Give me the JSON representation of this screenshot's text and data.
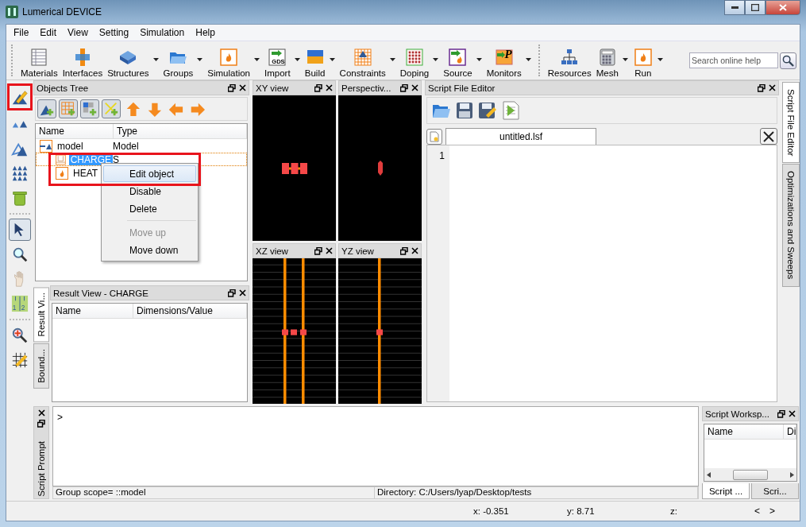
{
  "window": {
    "title": "Lumerical DEVICE"
  },
  "menu": [
    "File",
    "Edit",
    "View",
    "Setting",
    "Simulation",
    "Help"
  ],
  "toolbar": {
    "groups": [
      [
        {
          "label": "Materials",
          "kind": "table",
          "has_menu": false
        },
        {
          "label": "Interfaces",
          "kind": "interface",
          "has_menu": false
        },
        {
          "label": "Structures",
          "kind": "block",
          "has_menu": true
        },
        {
          "label": "Groups",
          "kind": "folder",
          "has_menu": true
        },
        {
          "label": "Simulation",
          "kind": "flame",
          "has_menu": true
        },
        {
          "label": "Import",
          "kind": "import",
          "badge": "GDS",
          "has_menu": true
        },
        {
          "label": "Build",
          "kind": "layers",
          "has_menu": true
        },
        {
          "label": "Constraints",
          "kind": "grid",
          "has_menu": true
        },
        {
          "label": "Doping",
          "kind": "dots",
          "has_menu": true
        },
        {
          "label": "Source",
          "kind": "source",
          "has_menu": true
        },
        {
          "label": "Monitors",
          "kind": "monitor",
          "badge": "P",
          "has_menu": true
        }
      ],
      [
        {
          "label": "Resources",
          "kind": "tree",
          "has_menu": false
        },
        {
          "label": "Mesh",
          "kind": "calculator",
          "has_menu": true
        },
        {
          "label": "Run",
          "kind": "flame",
          "has_menu": true
        }
      ]
    ],
    "search": {
      "placeholder": "Search online help"
    }
  },
  "left_toolbar": [
    {
      "kind": "edit",
      "selected": false,
      "annotated": true,
      "disabled": false
    },
    {
      "kind": "small-triangles",
      "selected": false,
      "annotated": false,
      "disabled": false
    },
    {
      "kind": "triangle",
      "selected": false,
      "annotated": false,
      "disabled": false
    },
    {
      "kind": "triangle-grid",
      "selected": false,
      "annotated": false,
      "disabled": false
    },
    {
      "kind": "trash",
      "selected": false,
      "annotated": false,
      "disabled": false
    },
    {
      "kind": "separator"
    },
    {
      "kind": "pointer",
      "selected": true,
      "annotated": false,
      "disabled": false
    },
    {
      "kind": "zoom",
      "selected": false,
      "annotated": false,
      "disabled": false
    },
    {
      "kind": "hand",
      "selected": false,
      "annotated": false,
      "disabled": true
    },
    {
      "kind": "ruler",
      "digits": [
        "1",
        "2"
      ],
      "selected": false,
      "annotated": false,
      "disabled": false
    },
    {
      "kind": "separator"
    },
    {
      "kind": "zoom-move",
      "selected": false,
      "annotated": false,
      "disabled": false
    },
    {
      "kind": "grid-edit",
      "selected": false,
      "annotated": false,
      "disabled": false
    }
  ],
  "objects_tree": {
    "title": "Objects Tree",
    "columns": [
      "Name",
      "Type"
    ],
    "rows": [
      {
        "name": "model",
        "type": "Model",
        "kind": "model",
        "selected": false,
        "children": [
          {
            "name": "CHARGE",
            "type": "S",
            "kind": "solver",
            "selected": true,
            "annotated": true
          },
          {
            "name": "HEAT",
            "kind": "flame",
            "selected": false
          }
        ]
      }
    ]
  },
  "context_menu": {
    "items": [
      {
        "label": "Edit object",
        "selected": true,
        "disabled": false
      },
      {
        "label": "Disable",
        "selected": false,
        "disabled": false
      },
      {
        "label": "Delete",
        "selected": false,
        "disabled": false
      },
      {
        "kind": "separator"
      },
      {
        "label": "Move up",
        "selected": false,
        "disabled": true
      },
      {
        "label": "Move down",
        "selected": false,
        "disabled": false
      }
    ]
  },
  "result_view": {
    "title": "Result View - CHARGE",
    "columns": [
      "Name",
      "Dimensions/Value"
    ],
    "side_tabs": [
      {
        "label": "Result Vi...",
        "selected": true
      },
      {
        "label": "Bound...",
        "selected": false
      }
    ]
  },
  "views": [
    {
      "title": "XY view",
      "kind": "xy"
    },
    {
      "title": "Perspectiv...",
      "kind": "perspective"
    },
    {
      "title": "XZ view",
      "kind": "xz"
    },
    {
      "title": "YZ view",
      "kind": "yz"
    }
  ],
  "script_editor": {
    "title": "Script File Editor",
    "tab": "untitled.lsf",
    "line_numbers": [
      "1"
    ]
  },
  "side_tabs": [
    {
      "label": "Script File Editor",
      "selected": true
    },
    {
      "label": "Optimizations and Sweeps",
      "selected": false
    }
  ],
  "script_prompt": {
    "title": "Script Prompt",
    "prompt": ">",
    "scope": "Group scope= ::model",
    "directory": "Directory: C:/Users/lyap/Desktop/tests"
  },
  "workspace": {
    "title": "Script Worksp...",
    "columns": [
      "Name",
      "Di"
    ],
    "tabs": [
      {
        "label": "Script ...",
        "selected": true
      },
      {
        "label": "Scri...",
        "selected": false
      }
    ]
  },
  "status_bar": {
    "x": "x: -0.351",
    "y": "y: 8.71",
    "z": "z:",
    "prev": "<",
    "next": ">"
  }
}
